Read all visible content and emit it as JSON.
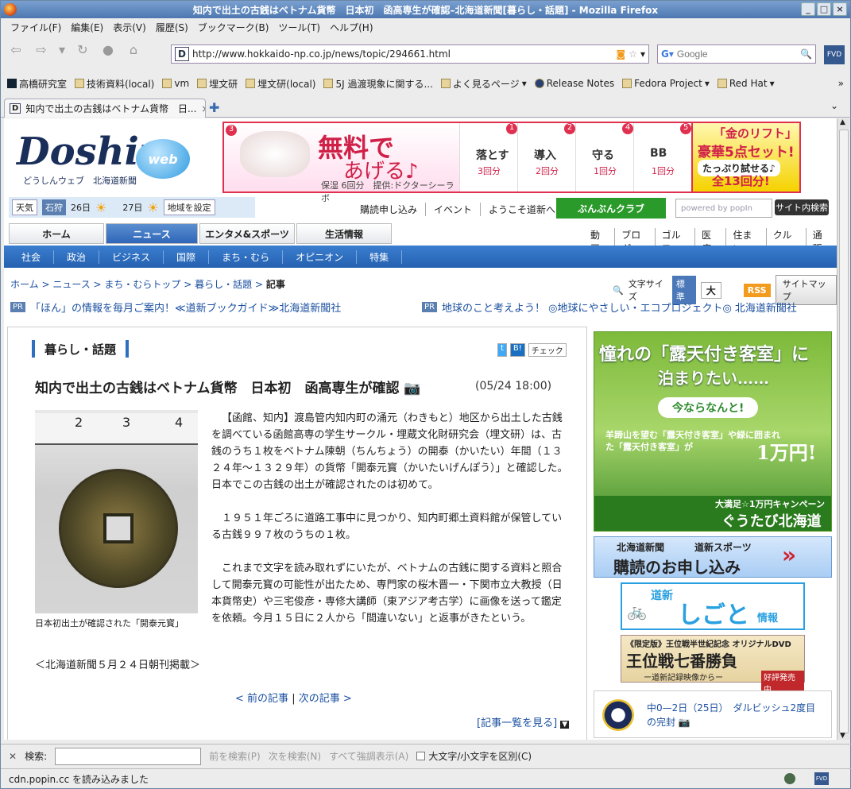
{
  "window": {
    "title": "知内で出土の古銭はベトナム貨幣　日本初　函高専生が確認–北海道新聞[暮らし・話題] - Mozilla Firefox",
    "buttons": [
      "_",
      "□",
      "×"
    ]
  },
  "menu": [
    "ファイル(F)",
    "編集(E)",
    "表示(V)",
    "履歴(S)",
    "ブックマーク(B)",
    "ツール(T)",
    "ヘルプ(H)"
  ],
  "nav": {
    "url": "http://www.hokkaido-np.co.jp/news/topic/294661.html",
    "search_placeholder": "Google",
    "fvd": "FVD"
  },
  "bookmarks": [
    "高橋研究室",
    "技術資料(local)",
    "vm",
    "埋文研",
    "埋文研(local)",
    "5J 過渡現象に関する...",
    "よく見るページ",
    "Release Notes",
    "Fedora Project",
    "Red Hat",
    "»"
  ],
  "tab": {
    "label": "知内で出土の古銭はベトナム貨幣　日..."
  },
  "page": {
    "logo": {
      "main": "Doshin",
      "badge": "web",
      "sub": "どうしんウェブ　北海道新聞"
    },
    "banner": {
      "headline1": "無料で",
      "headline2": "あげる♪",
      "note": "保湿 6回分　提供:ドクターシーラボ",
      "products": [
        {
          "num": "1",
          "name": "落とす",
          "count": "3回分"
        },
        {
          "num": "2",
          "name": "導入",
          "count": "2回分"
        },
        {
          "num": "4",
          "name": "守る",
          "count": "1回分"
        },
        {
          "num": "5",
          "name": "BB",
          "count": "1回分"
        }
      ],
      "last1": "「金のリフト」",
      "last2": "豪華5点セット!",
      "last3": "たっぷり試せる♪",
      "last4": "全13回分!"
    },
    "weather": {
      "label": "天気",
      "location": "石狩",
      "day1": "26日",
      "day2": "27日",
      "set": "地域を設定"
    },
    "top_links": [
      "購読申し込み",
      "イベント",
      "ようこそ道新へ"
    ],
    "bunbun": "ぶんぶんクラブ",
    "poplin": "powered by popIn",
    "site_search": "サイト内検索",
    "gnav": [
      "ホーム",
      "ニュース",
      "エンタメ&スポーツ",
      "生活情報"
    ],
    "gsub": [
      "動画",
      "ブログ",
      "ゴルフ",
      "医療",
      "住まい",
      "クルマ",
      "通販"
    ],
    "categories": [
      "社会",
      "政治",
      "ビジネス",
      "国際",
      "まち・むら",
      "オピニオン",
      "特集"
    ],
    "breadcrumb": [
      "ホーム",
      "ニュース",
      "まち・むらトップ",
      "暮らし・話題",
      "記事"
    ],
    "tools": {
      "fontsize": "文字サイズ",
      "std": "標準",
      "large": "大",
      "rss": "RSS",
      "sitemap": "サイトマップ"
    },
    "pr1": "「ほん」の情報を毎月ご案内！≪道新ブックガイド≫北海道新聞社",
    "pr2": "地球のこと考えよう！ ◎地球にやさしい・エコプロジェクト◎ 北海道新聞社",
    "pr_tag": "PR",
    "section": "暮らし・話題",
    "social": [
      "t",
      "B!",
      "チェック"
    ],
    "headline": "知内で出土の古銭はベトナム貨幣　日本初　函高専生が確認",
    "date": "(05/24 18:00)",
    "ruler": [
      "2",
      "3",
      "4"
    ],
    "caption": "日本初出土が確認された「開泰元寳」",
    "paragraphs": [
      "【函館、知内】渡島管内知内町の涌元（わきもと）地区から出土した古銭を調べている函館高専の学生サークル・埋蔵文化財研究会（埋文研）は、古銭のうち１枚をベトナム陳朝（ちんちょう）の開泰（かいたい）年間（１３２４年〜１３２９年）の貨幣「開泰元寳（かいたいげんぽう）」と確認した。日本でこの古銭の出土が確認されたのは初めて。",
      "１９５１年ごろに道路工事中に見つかり、知内町郷土資料館が保管している古銭９９７枚のうちの１枚。",
      "これまで文字を読み取れずにいたが、ベトナムの古銭に関する資料と照合して開泰元寳の可能性が出たため、専門家の桜木晋一・下関市立大教授（日本貨幣史）や三宅俊彦・専修大講師（東アジア考古学）に画像を送って鑑定を依頼。今月１５日に２人から「間違いない」と返事がきたという。"
    ],
    "source": "＜北海道新聞５月２４日朝刊掲載＞",
    "pager": {
      "lt": "<",
      "prev": "前の記事",
      "sep": "|",
      "next": "次の記事",
      "gt": ">"
    },
    "list": "[記事一覧を見る]",
    "ad1": {
      "t1": "憧れの「露天付き客室」に",
      "t2": "泊まりたい……",
      "pill": "今ならなんと!",
      "t3": "羊蹄山を望む「露天付き客室」や緑に囲まれた「露天付き客室」が",
      "price": "1万円!",
      "foot_a": "大満足☆1万円キャンペーン",
      "foot_b": "ぐうたび北海道"
    },
    "ad2": {
      "a": "北海道新聞",
      "b": "道新スポーツ",
      "c": "購読のお申し込み"
    },
    "ad3": {
      "a": "道新",
      "b": "しごと",
      "c": "情報"
    },
    "ad4": {
      "a": "《限定版》王位戦半世紀記念 オリジナルDVD",
      "b": "王位戦七番勝負",
      "c": "ー道新記録映像からー",
      "d": "好評発売中"
    },
    "fighters": "中0—2日（25日）　ダルビッシュ2度目の完封"
  },
  "findbar": {
    "label": "検索:",
    "prev": "前を検索(P)",
    "next": "次を検索(N)",
    "highlight": "すべて強調表示(A)",
    "case": "大文字/小文字を区別(C)"
  },
  "status": "cdn.popin.cc を読み込みました"
}
